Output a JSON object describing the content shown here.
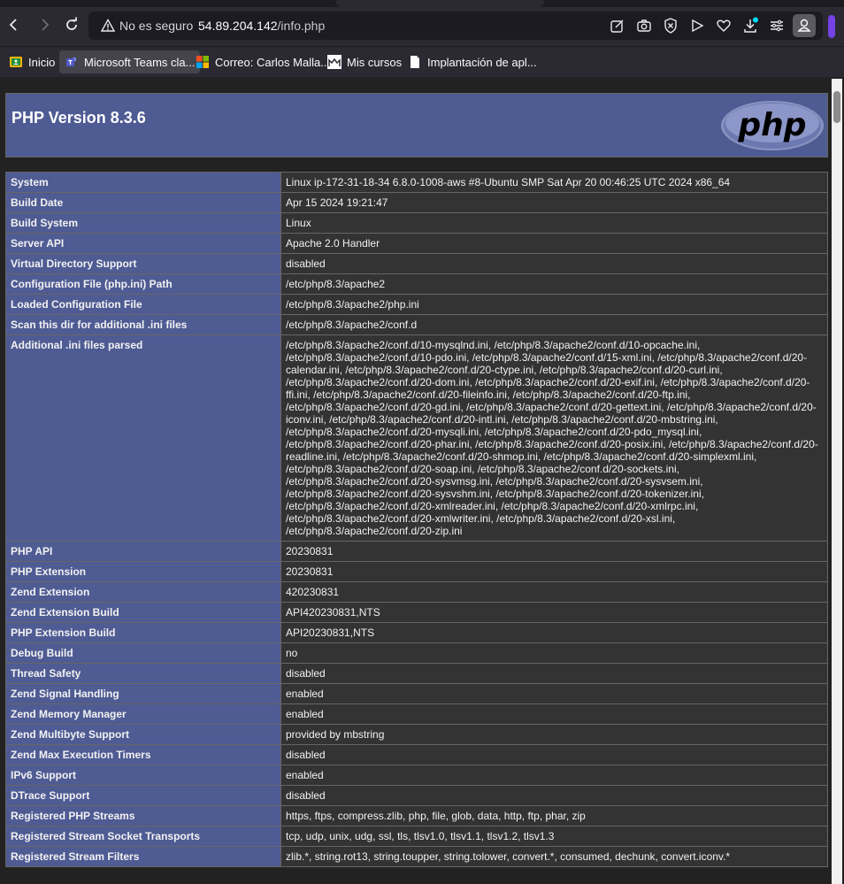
{
  "browser": {
    "url_warning": "No es seguro",
    "url_host": "54.89.204.142",
    "url_path": "/info.php",
    "bookmarks": [
      {
        "label": "Inicio",
        "icon": "classroom-icon"
      },
      {
        "label": "Microsoft Teams cla...",
        "icon": "teams-icon"
      },
      {
        "label": "Correo: Carlos Malla...",
        "icon": "microsoft-icon"
      },
      {
        "label": "Mis cursos",
        "icon": "moodle-icon"
      },
      {
        "label": "Implantación de apl...",
        "icon": "document-icon"
      }
    ],
    "colors": {
      "chrome": "#2b2a33",
      "accent": "#7542e5"
    }
  },
  "phpinfo": {
    "title": "PHP Version 8.3.6",
    "colors": {
      "header": "#4f5b93",
      "value_bg": "#333333"
    },
    "rows": [
      {
        "k": "System",
        "v": "Linux ip-172-31-18-34 6.8.0-1008-aws #8-Ubuntu SMP Sat Apr 20 00:46:25 UTC 2024 x86_64"
      },
      {
        "k": "Build Date",
        "v": "Apr 15 2024 19:21:47"
      },
      {
        "k": "Build System",
        "v": "Linux"
      },
      {
        "k": "Server API",
        "v": "Apache 2.0 Handler"
      },
      {
        "k": "Virtual Directory Support",
        "v": "disabled"
      },
      {
        "k": "Configuration File (php.ini) Path",
        "v": "/etc/php/8.3/apache2"
      },
      {
        "k": "Loaded Configuration File",
        "v": "/etc/php/8.3/apache2/php.ini"
      },
      {
        "k": "Scan this dir for additional .ini files",
        "v": "/etc/php/8.3/apache2/conf.d"
      },
      {
        "k": "Additional .ini files parsed",
        "v": "/etc/php/8.3/apache2/conf.d/10-mysqlnd.ini, /etc/php/8.3/apache2/conf.d/10-opcache.ini, /etc/php/8.3/apache2/conf.d/10-pdo.ini, /etc/php/8.3/apache2/conf.d/15-xml.ini, /etc/php/8.3/apache2/conf.d/20-calendar.ini, /etc/php/8.3/apache2/conf.d/20-ctype.ini, /etc/php/8.3/apache2/conf.d/20-curl.ini, /etc/php/8.3/apache2/conf.d/20-dom.ini, /etc/php/8.3/apache2/conf.d/20-exif.ini, /etc/php/8.3/apache2/conf.d/20-ffi.ini, /etc/php/8.3/apache2/conf.d/20-fileinfo.ini, /etc/php/8.3/apache2/conf.d/20-ftp.ini, /etc/php/8.3/apache2/conf.d/20-gd.ini, /etc/php/8.3/apache2/conf.d/20-gettext.ini, /etc/php/8.3/apache2/conf.d/20-iconv.ini, /etc/php/8.3/apache2/conf.d/20-intl.ini, /etc/php/8.3/apache2/conf.d/20-mbstring.ini, /etc/php/8.3/apache2/conf.d/20-mysqli.ini, /etc/php/8.3/apache2/conf.d/20-pdo_mysql.ini, /etc/php/8.3/apache2/conf.d/20-phar.ini, /etc/php/8.3/apache2/conf.d/20-posix.ini, /etc/php/8.3/apache2/conf.d/20-readline.ini, /etc/php/8.3/apache2/conf.d/20-shmop.ini, /etc/php/8.3/apache2/conf.d/20-simplexml.ini, /etc/php/8.3/apache2/conf.d/20-soap.ini, /etc/php/8.3/apache2/conf.d/20-sockets.ini, /etc/php/8.3/apache2/conf.d/20-sysvmsg.ini, /etc/php/8.3/apache2/conf.d/20-sysvsem.ini, /etc/php/8.3/apache2/conf.d/20-sysvshm.ini, /etc/php/8.3/apache2/conf.d/20-tokenizer.ini, /etc/php/8.3/apache2/conf.d/20-xmlreader.ini, /etc/php/8.3/apache2/conf.d/20-xmlrpc.ini, /etc/php/8.3/apache2/conf.d/20-xmlwriter.ini, /etc/php/8.3/apache2/conf.d/20-xsl.ini, /etc/php/8.3/apache2/conf.d/20-zip.ini"
      },
      {
        "k": "PHP API",
        "v": "20230831"
      },
      {
        "k": "PHP Extension",
        "v": "20230831"
      },
      {
        "k": "Zend Extension",
        "v": "420230831"
      },
      {
        "k": "Zend Extension Build",
        "v": "API420230831,NTS"
      },
      {
        "k": "PHP Extension Build",
        "v": "API20230831,NTS"
      },
      {
        "k": "Debug Build",
        "v": "no"
      },
      {
        "k": "Thread Safety",
        "v": "disabled"
      },
      {
        "k": "Zend Signal Handling",
        "v": "enabled"
      },
      {
        "k": "Zend Memory Manager",
        "v": "enabled"
      },
      {
        "k": "Zend Multibyte Support",
        "v": "provided by mbstring"
      },
      {
        "k": "Zend Max Execution Timers",
        "v": "disabled"
      },
      {
        "k": "IPv6 Support",
        "v": "enabled"
      },
      {
        "k": "DTrace Support",
        "v": "disabled"
      },
      {
        "k": "Registered PHP Streams",
        "v": "https, ftps, compress.zlib, php, file, glob, data, http, ftp, phar, zip"
      },
      {
        "k": "Registered Stream Socket Transports",
        "v": "tcp, udp, unix, udg, ssl, tls, tlsv1.0, tlsv1.1, tlsv1.2, tlsv1.3"
      },
      {
        "k": "Registered Stream Filters",
        "v": "zlib.*, string.rot13, string.toupper, string.tolower, convert.*, consumed, dechunk, convert.iconv.*"
      }
    ]
  }
}
